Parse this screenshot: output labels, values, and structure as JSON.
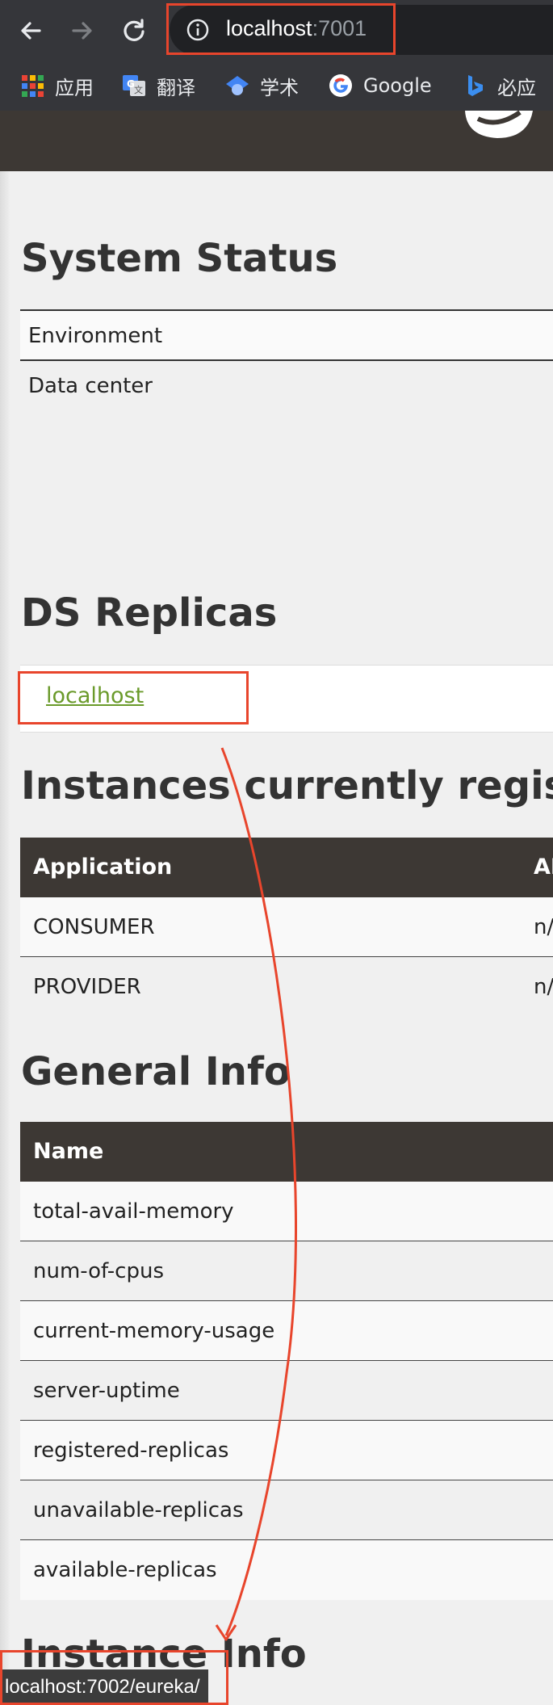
{
  "browser": {
    "url_host": "localhost",
    "url_port": ":7001",
    "bookmarks": [
      {
        "label": "应用",
        "icon": "apps-grid-icon"
      },
      {
        "label": "翻译",
        "icon": "google-translate-icon"
      },
      {
        "label": "学术",
        "icon": "scholar-icon"
      },
      {
        "label": "Google",
        "icon": "google-icon"
      },
      {
        "label": "必应",
        "icon": "bing-icon"
      }
    ],
    "status_url": "localhost:7002/eureka/"
  },
  "system_status": {
    "title": "System Status",
    "rows": [
      {
        "label": "Environment"
      },
      {
        "label": "Data center"
      }
    ]
  },
  "ds_replicas": {
    "title": "DS Replicas",
    "link": "localhost"
  },
  "instances": {
    "title": "Instances currently register",
    "columns": [
      "Application",
      "AI"
    ],
    "rows": [
      {
        "app": "CONSUMER",
        "ami": "n/"
      },
      {
        "app": "PROVIDER",
        "ami": "n/"
      }
    ]
  },
  "general_info": {
    "title": "General Info",
    "column": "Name",
    "rows": [
      "total-avail-memory",
      "num-of-cpus",
      "current-memory-usage",
      "server-uptime",
      "registered-replicas",
      "unavailable-replicas",
      "available-replicas"
    ]
  },
  "instance_info": {
    "title": "Instance Info"
  },
  "colors": {
    "annotation": "#e8452c",
    "header_dark": "#3d3834",
    "link_green": "#6a9a2a"
  }
}
